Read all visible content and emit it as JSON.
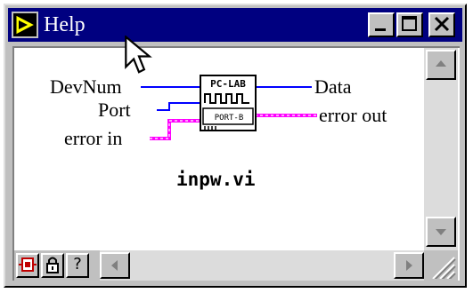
{
  "window": {
    "title": "Help"
  },
  "diagram": {
    "inputs": {
      "devnum": "DevNum",
      "port": "Port",
      "error_in": "error in"
    },
    "outputs": {
      "data": "Data",
      "error_out": "error out"
    },
    "vi_icon": {
      "top_label": "PC-LAB",
      "bottom_label": "PORT-B"
    },
    "vi_name": "inpw.vi"
  },
  "icons": {
    "app": "labview-run-arrow-icon",
    "minimize": "minimize-icon",
    "maximize": "maximize-icon",
    "close": "close-icon",
    "show_block_diagram": "diagram-icon",
    "lock": "lock-icon",
    "help": "question-icon",
    "cursor": "mouse-pointer-icon"
  },
  "bottom_bar": {
    "help_glyph": "?"
  },
  "colors": {
    "titlebar": "#000080",
    "wire_numeric": "#0000ff",
    "wire_cluster": "#ff00ff"
  }
}
